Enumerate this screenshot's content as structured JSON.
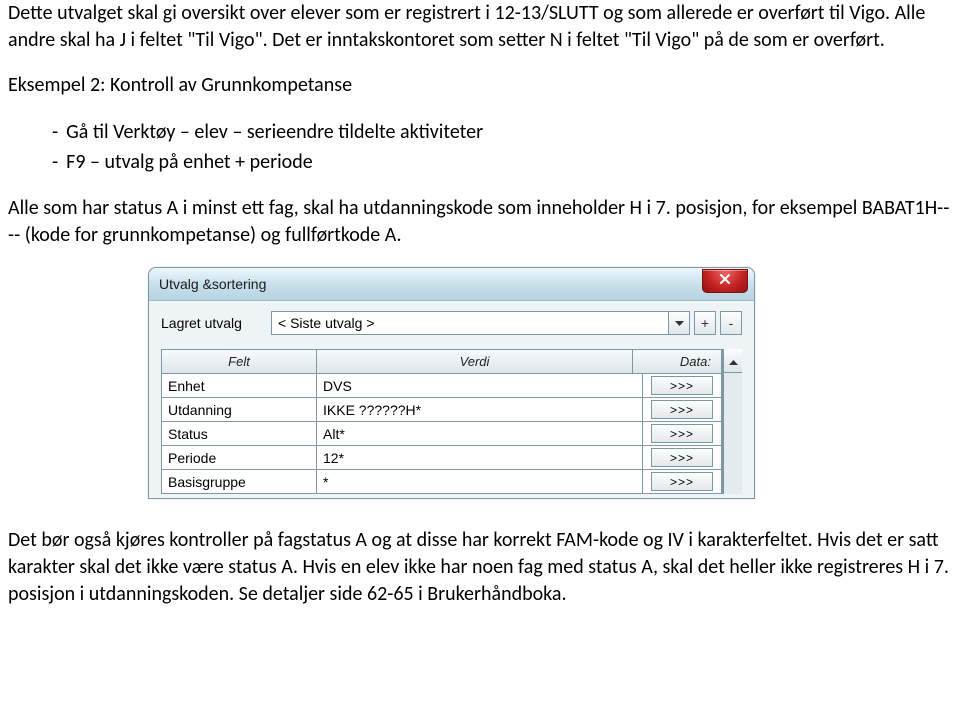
{
  "text": {
    "p1": "Dette utvalget skal gi oversikt over elever som er registrert i 12-13/SLUTT og som allerede er overført til Vigo. Alle andre skal ha J i feltet \"Til Vigo\". Det er inntakskontoret som setter N i feltet \"Til Vigo\" på de som er overført.",
    "p2": "Eksempel 2: Kontroll av Grunnkompetanse",
    "b1": "Gå til Verktøy – elev – serieendre tildelte aktiviteter",
    "b2": "F9 – utvalg på enhet + periode",
    "p3": "Alle som har status A i minst ett fag, skal ha utdanningskode som inneholder H i 7. posisjon, for eksempel BABAT1H---- (kode for grunnkompetanse) og fullførtkode A.",
    "p4": "Det bør også kjøres kontroller på fagstatus A og at disse har korrekt FAM-kode og IV i karakterfeltet. Hvis det er satt karakter skal det ikke være status A. Hvis en elev ikke har noen fag med status A, skal det heller ikke registreres H i 7. posisjon i utdanningskoden. Se detaljer side 62-65 i Brukerhåndboka."
  },
  "dialog": {
    "title": "Utvalg &sortering",
    "saved_label": "Lagret utvalg",
    "saved_value": "< Siste utvalg >",
    "plus": "+",
    "minus": "-",
    "headers": {
      "felt": "Felt",
      "verdi": "Verdi",
      "data": "Data:"
    },
    "dots": ">>>",
    "rows": [
      {
        "felt": "Enhet",
        "verdi": "DVS"
      },
      {
        "felt": "Utdanning",
        "verdi": "IKKE ??????H*"
      },
      {
        "felt": "Status",
        "verdi": "Alt*"
      },
      {
        "felt": "Periode",
        "verdi": "12*"
      },
      {
        "felt": "Basisgruppe",
        "verdi": "*"
      }
    ]
  }
}
